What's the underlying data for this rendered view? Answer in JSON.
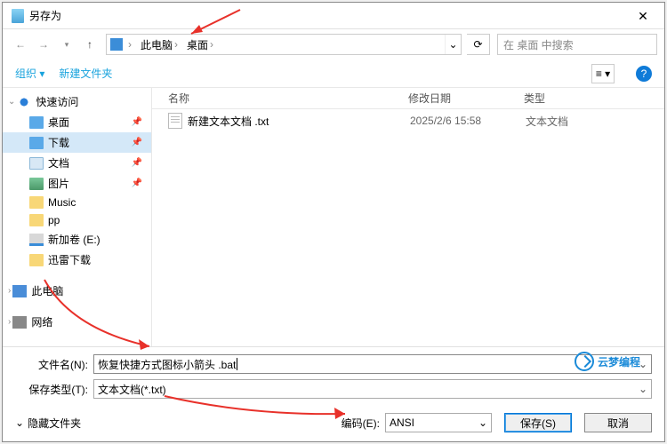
{
  "title": "另存为",
  "breadcrumb": {
    "root": "此电脑",
    "folder": "桌面"
  },
  "search_placeholder": "在 桌面 中搜索",
  "toolbar": {
    "organize": "组织 ▾",
    "newfolder": "新建文件夹"
  },
  "columns": {
    "name": "名称",
    "modified": "修改日期",
    "type": "类型"
  },
  "sidebar": {
    "quick": "快速访问",
    "items": [
      {
        "label": "桌面",
        "cls": "folder blue",
        "pin": true
      },
      {
        "label": "下载",
        "cls": "folder blue",
        "pin": true,
        "selected": true
      },
      {
        "label": "文档",
        "cls": "folder doc",
        "pin": true
      },
      {
        "label": "图片",
        "cls": "folder pic",
        "pin": true
      },
      {
        "label": "Music",
        "cls": "folder",
        "pin": false
      },
      {
        "label": "pp",
        "cls": "folder",
        "pin": false
      },
      {
        "label": "新加卷 (E:)",
        "cls": "drive",
        "pin": false
      },
      {
        "label": "迅雷下载",
        "cls": "folder",
        "pin": false
      }
    ],
    "this_pc": "此电脑",
    "network": "网络"
  },
  "files": [
    {
      "name": "新建文本文档 .txt",
      "date": "2025/2/6 15:58",
      "type": "文本文档"
    }
  ],
  "fields": {
    "filename_label": "文件名(N):",
    "filename_value": "恢复快捷方式图标小箭头 .bat",
    "filetype_label": "保存类型(T):",
    "filetype_value": "文本文档(*.txt)"
  },
  "hide_folders": "隐藏文件夹",
  "encoding": {
    "label": "编码(E):",
    "value": "ANSI"
  },
  "buttons": {
    "save": "保存(S)",
    "cancel": "取消"
  },
  "watermark": "云梦编程"
}
